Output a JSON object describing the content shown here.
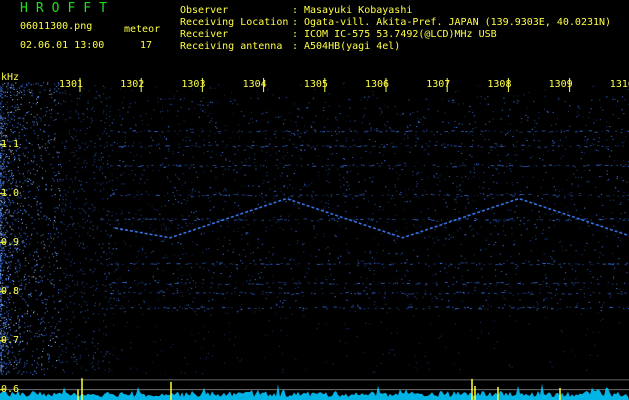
{
  "header": {
    "brand": "HROFFT",
    "filename": "06011300.png",
    "datetime": "02.06.01 13:00",
    "meteor_label": "meteor",
    "meteor_count": "17",
    "info_rows": [
      {
        "label": "Observer",
        "sep": ":",
        "value": "Masayuki Kobayashi"
      },
      {
        "label": "Receiving Location",
        "sep": ":",
        "value": "Ogata-vill. Akita-Pref. JAPAN (139.9303E, 40.0231N)"
      },
      {
        "label": "Receiver",
        "sep": ":",
        "value": "ICOM IC-575 53.7492(@LCD)MHz USB"
      },
      {
        "label": "Receiving antenna",
        "sep": ":",
        "value": "A504HB(yagi 4el)"
      }
    ]
  },
  "chart_data": {
    "type": "heatmap",
    "title": "",
    "ylabel": "kHz",
    "x_tick_labels": [
      "1301",
      "1302",
      "1303",
      "1304",
      "1305",
      "1306",
      "1307",
      "1308",
      "1309",
      "1310"
    ],
    "y_tick_labels": [
      "1.1",
      "1.0",
      "0.9",
      "0.8",
      "0.7",
      "0.6"
    ],
    "y_ticks": [
      1.1,
      1.0,
      0.9,
      0.8,
      0.7,
      0.6
    ],
    "xlim": [
      1300,
      1310.5
    ],
    "ylim": [
      0.58,
      1.2
    ],
    "horizontal_lines_khz": [
      0.62,
      0.6
    ],
    "noise_band_khz": [
      0.76,
      1.2
    ],
    "carrier_tracks": [
      {
        "x": [
          1301.9,
          1302.8,
          1304.7,
          1306.6,
          1308.5,
          1310.4
        ],
        "y": [
          0.93,
          0.91,
          0.99,
          0.91,
          0.99,
          0.91
        ]
      }
    ],
    "colors": {
      "background": "#000000",
      "signal": "#3b7cff",
      "noise_bright": "#aaccff",
      "ticks": "#ffff44",
      "baseline": "#00c8ff",
      "meteor_spike": "#ffff33",
      "hline": "#bbbbbb"
    }
  }
}
